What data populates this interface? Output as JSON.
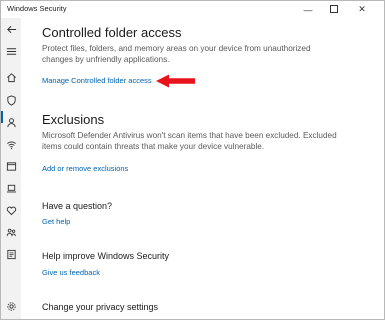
{
  "window": {
    "title": "Windows Security",
    "minimize_icon": "minimize-icon",
    "maximize_icon": "maximize-icon",
    "close_icon": "close-icon"
  },
  "sidebar": {
    "accent_color": "#0063b1",
    "icons": [
      "back-arrow-icon",
      "hamburger-menu-icon",
      "home-icon",
      "shield-icon",
      "person-icon",
      "wifi-icon",
      "browser-icon",
      "laptop-icon",
      "heart-icon",
      "family-icon",
      "history-icon",
      "gear-icon"
    ]
  },
  "sections": {
    "controlled_folder": {
      "title": "Controlled folder access",
      "description": "Protect files, folders, and memory areas on your device from unauthorized changes by unfriendly applications.",
      "link": "Manage Controlled folder access"
    },
    "exclusions": {
      "title": "Exclusions",
      "description": "Microsoft Defender Antivirus won't scan items that have been excluded. Excluded items could contain threats that make your device vulnerable.",
      "link": "Add or remove exclusions"
    },
    "question": {
      "title": "Have a question?",
      "link": "Get help"
    },
    "improve": {
      "title": "Help improve Windows Security",
      "link": "Give us feedback"
    },
    "privacy": {
      "title": "Change your privacy settings"
    }
  },
  "annotation": {
    "arrow_color": "#e8141b"
  }
}
